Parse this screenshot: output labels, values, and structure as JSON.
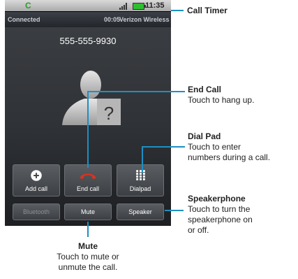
{
  "status_bar": {
    "carrier_icon": "C",
    "time": "11:35"
  },
  "call_bar": {
    "state": "Connected",
    "duration": "00:05",
    "carrier": "Verizon Wireless"
  },
  "phone_number": "555-555-9930",
  "contact_photo": {
    "placeholder": "?"
  },
  "buttons": {
    "add_call": "Add call",
    "end_call": "End call",
    "dialpad": "Dialpad",
    "bluetooth": "Bluetooth",
    "mute": "Mute",
    "speaker": "Speaker"
  },
  "callouts": {
    "call_timer": {
      "title": "Call Timer"
    },
    "end_call": {
      "title": "End Call",
      "desc": "Touch to hang up."
    },
    "dial_pad": {
      "title": "Dial Pad",
      "desc1": "Touch to enter",
      "desc2": "numbers during a call."
    },
    "speakerphone": {
      "title": "Speakerphone",
      "desc1": "Touch to turn the",
      "desc2": "speakerphone on",
      "desc3": "or off."
    },
    "mute": {
      "title": "Mute",
      "desc1": "Touch to mute or",
      "desc2": "unmute the call."
    }
  },
  "colors": {
    "callout_line": "#1d8fc5",
    "end_call_red": "#e0301e",
    "battery": "#2fbe2f"
  }
}
